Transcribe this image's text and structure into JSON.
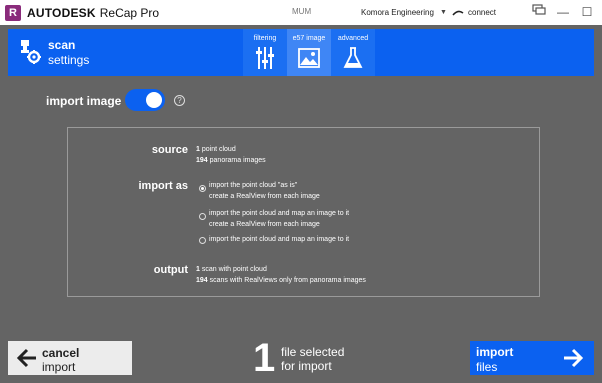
{
  "titlebar": {
    "logo_letter": "R",
    "brand": "AUTODESK",
    "product": "ReCap Pro",
    "center_text": "MUM",
    "account": "Komora Engineering",
    "connect": "connect",
    "icons": [
      "chat-icon",
      "minimize-icon",
      "maximize-icon",
      "close-icon"
    ]
  },
  "header": {
    "title_line1": "scan",
    "title_line2": "settings",
    "tabs": [
      {
        "label": "filtering",
        "icon": "sliders-icon",
        "active": false
      },
      {
        "label": "e57 image",
        "icon": "image-icon",
        "active": true
      },
      {
        "label": "advanced",
        "icon": "flask-icon",
        "active": false
      }
    ]
  },
  "import_image": {
    "label": "import image",
    "enabled": true
  },
  "panel": {
    "source": {
      "label": "source",
      "line1_count": "1",
      "line1_text": "point cloud",
      "line2_count": "194",
      "line2_text": "panorama images"
    },
    "import_as": {
      "label": "import as",
      "options": [
        {
          "line1": "import the point cloud \"as is\"",
          "line2": "create a RealView from each image",
          "checked": true
        },
        {
          "line1": "import the point cloud and map an image to it",
          "line2": "create a RealView from each image",
          "checked": false
        },
        {
          "line1": "import the point cloud and map an image to it",
          "line2": "",
          "checked": false
        }
      ]
    },
    "output": {
      "label": "output",
      "line1_count": "1",
      "line1_text": "scan with point cloud",
      "line2_count": "194",
      "line2_text": "scans with RealViews only from panorama images"
    }
  },
  "footer": {
    "cancel_line1": "cancel",
    "cancel_line2": "import",
    "count": "1",
    "count_line1": "file selected",
    "count_line2": "for import",
    "import_line1": "import",
    "import_line2": "files"
  },
  "colors": {
    "accent": "#0b61f0",
    "background": "#646464",
    "logo": "#8a2b7b"
  }
}
